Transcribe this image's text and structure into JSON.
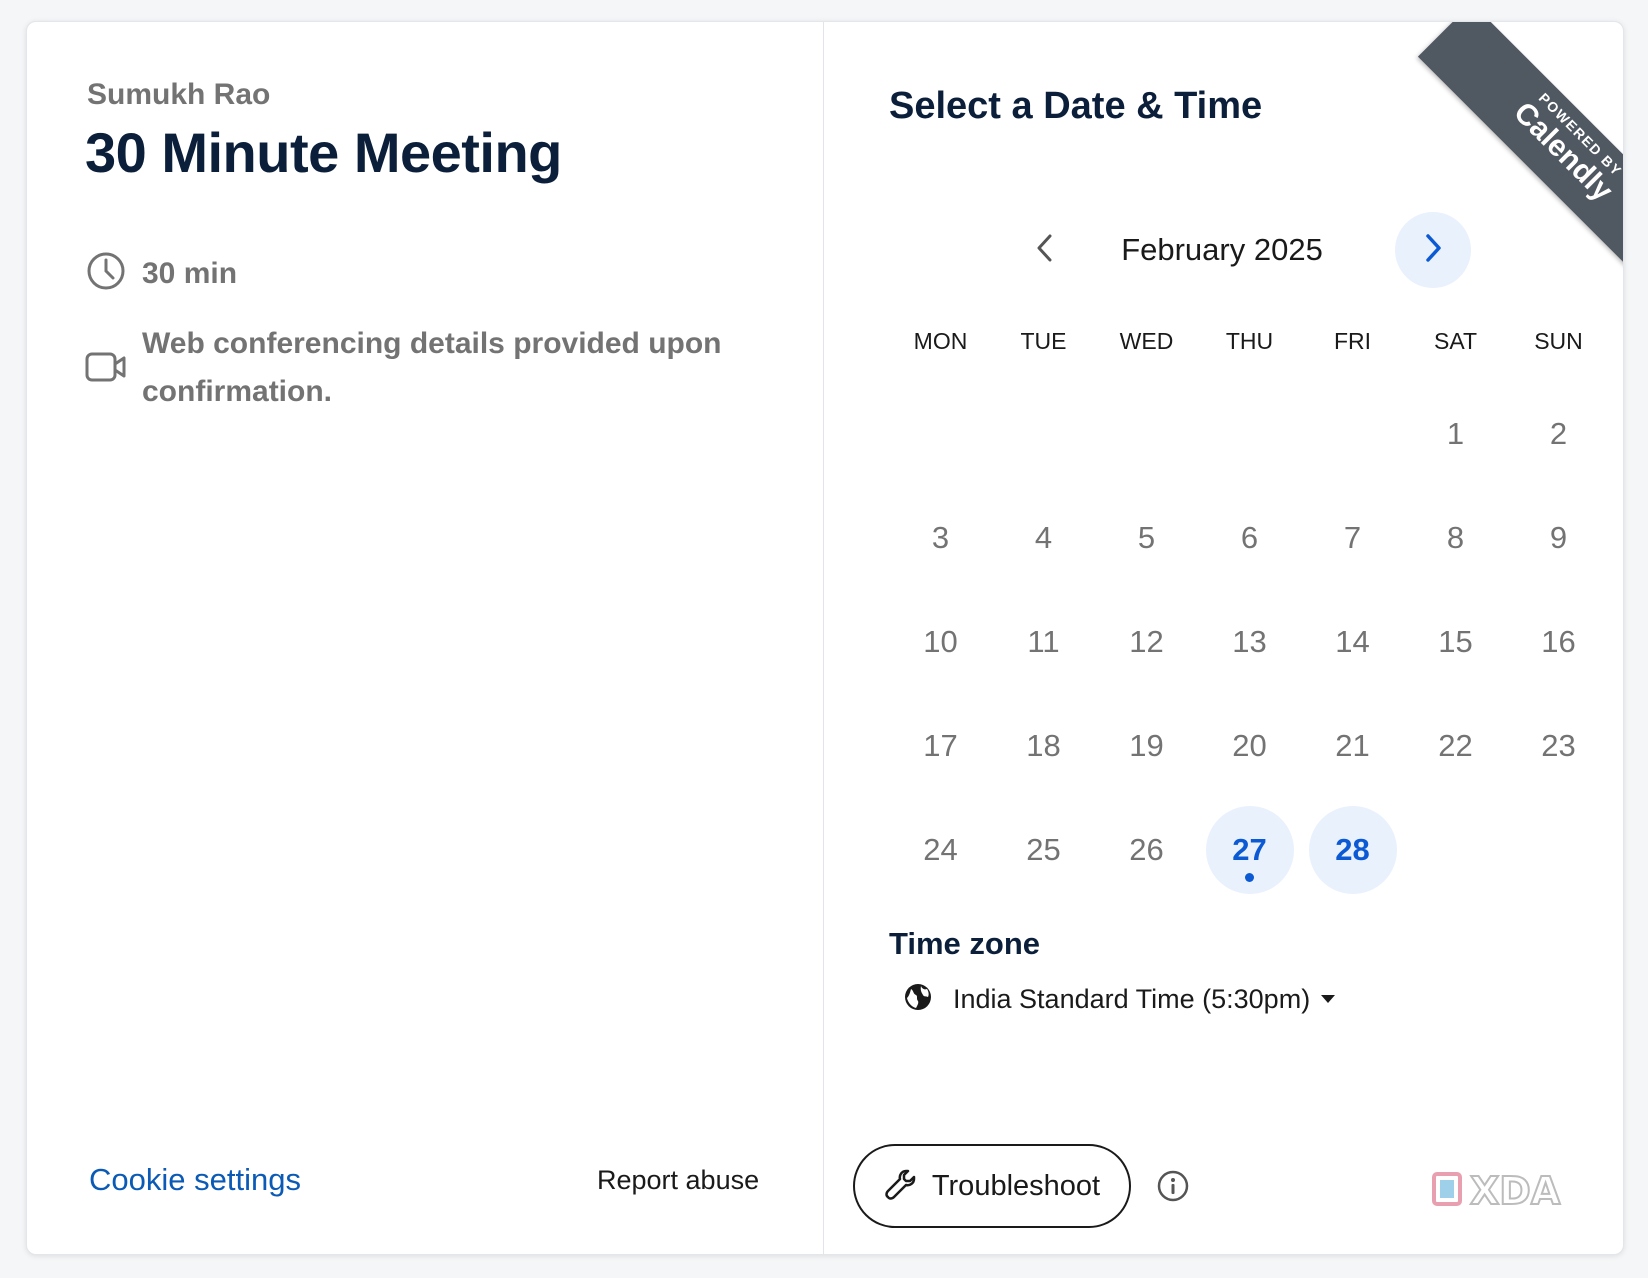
{
  "event": {
    "organizer": "Sumukh Rao",
    "title": "30 Minute Meeting",
    "duration": "30 min",
    "conferencing": "Web conferencing details provided upon confirmation."
  },
  "footer": {
    "cookie_settings": "Cookie settings",
    "report_abuse": "Report abuse"
  },
  "scheduler": {
    "heading": "Select a Date & Time",
    "ribbon_small": "POWERED BY",
    "ribbon_brand": "Calendly",
    "month": "February 2025",
    "weekdays": [
      "MON",
      "TUE",
      "WED",
      "THU",
      "FRI",
      "SAT",
      "SUN"
    ],
    "days": [
      "1",
      "2",
      "3",
      "4",
      "5",
      "6",
      "7",
      "8",
      "9",
      "10",
      "11",
      "12",
      "13",
      "14",
      "15",
      "16",
      "17",
      "18",
      "19",
      "20",
      "21",
      "22",
      "23",
      "24",
      "25",
      "26",
      "27",
      "28"
    ],
    "available_days": [
      "27",
      "28"
    ],
    "today": "27"
  },
  "timezone": {
    "label": "Time zone",
    "value": "India Standard Time (5:30pm)"
  },
  "actions": {
    "troubleshoot": "Troubleshoot"
  },
  "watermark": "XDA",
  "colors": {
    "accent": "#0b5ad4",
    "accent_bg": "#e9f1fd",
    "heading": "#0b1f3a",
    "muted": "#737373",
    "ribbon": "#505861"
  },
  "icons": {
    "duration": "clock-icon",
    "conferencing": "video-camera-icon",
    "timezone": "globe-icon",
    "troubleshoot": "wrench-icon",
    "info": "info-icon",
    "prev": "chevron-left-icon",
    "next": "chevron-right-icon",
    "dropdown": "caret-down-icon"
  }
}
